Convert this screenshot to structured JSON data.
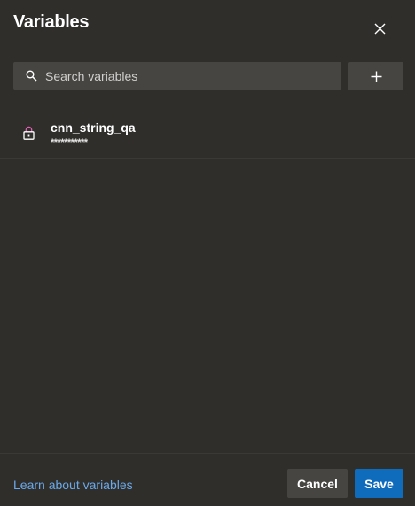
{
  "panel": {
    "title": "Variables",
    "close_icon": "close-icon"
  },
  "search": {
    "placeholder": "Search variables",
    "value": "",
    "icon": "search-icon"
  },
  "add_button": {
    "icon": "plus-icon"
  },
  "variables": [
    {
      "name": "cnn_string_qa",
      "value": "***********",
      "icon": "lock-icon",
      "secret": true
    }
  ],
  "footer": {
    "learn_link": "Learn about variables",
    "cancel_label": "Cancel",
    "save_label": "Save"
  },
  "colors": {
    "background": "#302e2b",
    "input_background": "#474542",
    "link": "#6aa9ea",
    "primary": "#0f6cbd",
    "lock_accent": "#e05fb4"
  }
}
